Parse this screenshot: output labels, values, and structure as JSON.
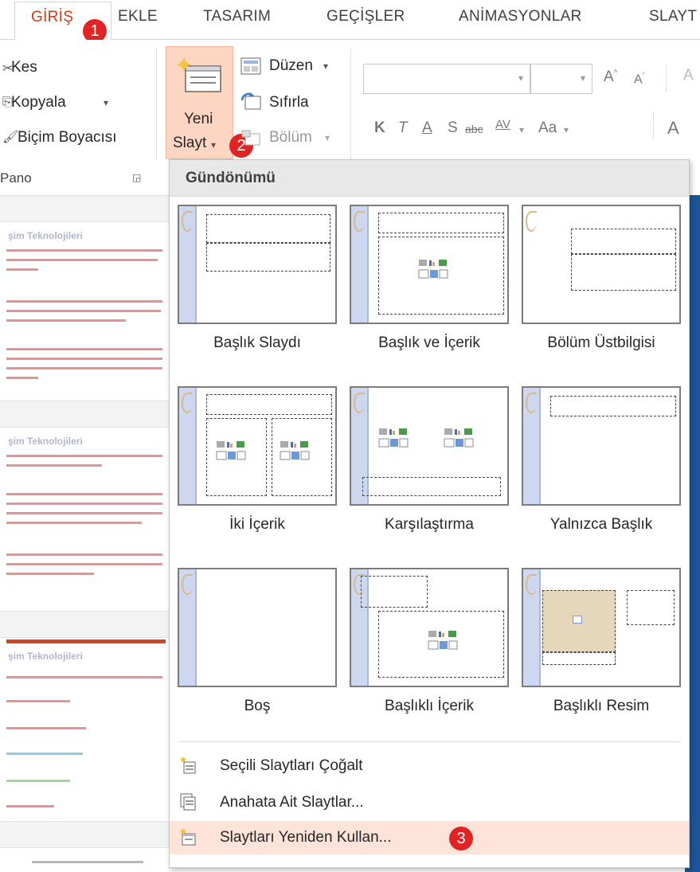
{
  "tabs": [
    {
      "label": "GİRİŞ",
      "active": true
    },
    {
      "label": "EKLE"
    },
    {
      "label": "TASARIM"
    },
    {
      "label": "GEÇİŞLER"
    },
    {
      "label": "ANİMASYONLAR"
    },
    {
      "label": "SLAYT"
    }
  ],
  "badges": {
    "b1": "1",
    "b2": "2",
    "b3": "3"
  },
  "clipboard": {
    "cut": "Kes",
    "copy": "Kopyala",
    "format_painter": "Biçim Boyacısı",
    "group_label": "Pano"
  },
  "slides": {
    "new_slide_line1": "Yeni",
    "new_slide_line2": "Slayt",
    "layout": "Düzen",
    "reset": "Sıfırla",
    "section": "Bölüm"
  },
  "font": {
    "bold": "K",
    "italic": "T",
    "underline": "A",
    "shadow": "S",
    "strike": "abc",
    "spacing": "AV",
    "case": "Aa",
    "clear": "A"
  },
  "thumbnails": {
    "title": "şim Teknolojileri"
  },
  "gallery": {
    "header": "Gündönümü",
    "layouts": [
      "Başlık Slaydı",
      "Başlık ve İçerik",
      "Bölüm Üstbilgisi",
      "İki İçerik",
      "Karşılaştırma",
      "Yalnızca Başlık",
      "Boş",
      "Başlıklı İçerik",
      "Başlıklı Resim"
    ],
    "commands": [
      "Seçili Slaytları Çoğalt",
      "Anahata Ait Slaytlar...",
      "Slaytları Yeniden Kullan..."
    ]
  },
  "colors": {
    "accent": "#c43e1c",
    "badge": "#e02424",
    "highlight": "#fde3d8",
    "new_slide_bg": "#fcd6c2"
  }
}
